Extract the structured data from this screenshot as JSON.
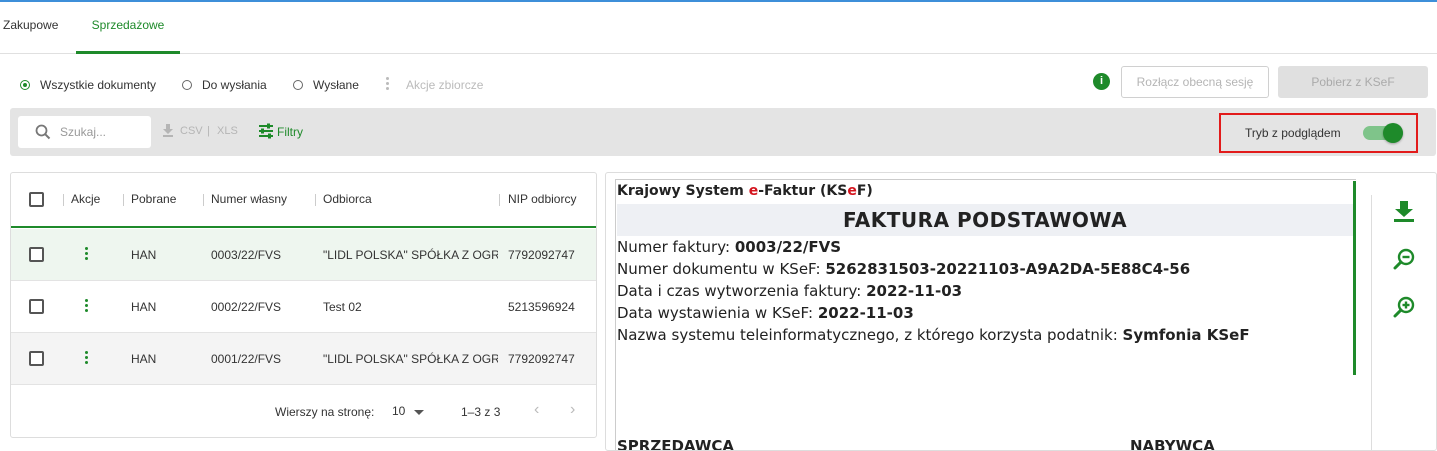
{
  "tabs": [
    {
      "label": "Zakupowe",
      "active": false
    },
    {
      "label": "Sprzedażowe",
      "active": true
    }
  ],
  "filters": {
    "radios": [
      {
        "label": "Wszystkie dokumenty",
        "selected": true
      },
      {
        "label": "Do wysłania",
        "selected": false
      },
      {
        "label": "Wysłane",
        "selected": false
      }
    ],
    "bulk_actions_label": "Akcje zbiorcze",
    "disconnect_label": "Rozłącz obecną sesję",
    "fetch_label": "Pobierz z KSeF"
  },
  "toolbar": {
    "search_placeholder": "Szukaj...",
    "export_csv": "CSV",
    "export_sep": "|",
    "export_xls": "XLS",
    "filters_label": "Filtry",
    "preview_mode_label": "Tryb z podglądem",
    "preview_mode_on": true
  },
  "table": {
    "columns": [
      "Akcje",
      "Pobrane",
      "Numer własny",
      "Odbiorca",
      "NIP odbiorcy"
    ],
    "rows": [
      {
        "pobrane": "HAN",
        "numer": "0003/22/FVS",
        "odbiorca": "\"LIDL POLSKA\" SPÓŁKA Z OGRANICZONĄ ODPOWIEDZIALNOŚCIĄ",
        "nip": "7792092747"
      },
      {
        "pobrane": "HAN",
        "numer": "0002/22/FVS",
        "odbiorca": "Test 02",
        "nip": "5213596924"
      },
      {
        "pobrane": "HAN",
        "numer": "0001/22/FVS",
        "odbiorca": "\"LIDL POLSKA\" SPÓŁKA Z OGRANICZONĄ ODPOWIEDZIALNOŚCIĄ",
        "nip": "7792092747"
      }
    ],
    "pager": {
      "rows_per_page_label": "Wierszy na stronę:",
      "rows_per_page": "10",
      "range": "1–3 z 3"
    }
  },
  "document": {
    "header_pre": "Krajowy System ",
    "header_e": "e",
    "header_mid": "-Faktur (KS",
    "header_e2": "e",
    "header_post": "F)",
    "banner": "FAKTURA PODSTAWOWA",
    "lines": [
      {
        "label": "Numer faktury: ",
        "value": "0003/22/FVS"
      },
      {
        "label": "Numer dokumentu w KSeF: ",
        "value": "5262831503-20221103-A9A2DA-5E88C4-56"
      },
      {
        "label": "Data i czas wytworzenia faktury: ",
        "value": "2022-11-03"
      },
      {
        "label": "Data wystawienia w KSeF: ",
        "value": "2022-11-03"
      },
      {
        "label": "Nazwa systemu teleinformatycznego, z którego korzysta podatnik: ",
        "value": "Symfonia KSeF"
      }
    ],
    "seller_heading": "SPRZEDAWCA",
    "buyer_heading": "NABYWCA"
  },
  "side_icons": [
    "download-icon",
    "zoom-out-icon",
    "zoom-in-icon"
  ],
  "colors": {
    "accent": "#1e8a2a",
    "highlight_border": "#e21b1b",
    "ksef_red": "#d4141e"
  }
}
